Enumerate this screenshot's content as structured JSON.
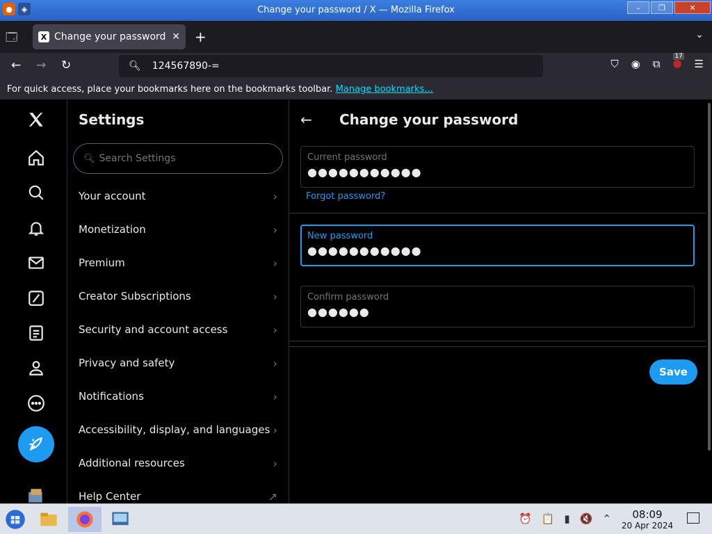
{
  "window": {
    "title": "Change your password / X — Mozilla Firefox",
    "minimize": "–",
    "maximize": "❐",
    "close": "✕"
  },
  "browser": {
    "tab_title": "Change your password /",
    "tab_favicon": "X",
    "url": "124567890-=",
    "extension_badge_count": "17",
    "bookmarks_message": "For quick access, place your bookmarks here on the bookmarks toolbar.",
    "manage_bookmarks": "Manage bookmarks..."
  },
  "settings": {
    "title": "Settings",
    "search_placeholder": "Search Settings",
    "items": [
      {
        "label": "Your account"
      },
      {
        "label": "Monetization"
      },
      {
        "label": "Premium"
      },
      {
        "label": "Creator Subscriptions"
      },
      {
        "label": "Security and account access"
      },
      {
        "label": "Privacy and safety"
      },
      {
        "label": "Notifications"
      },
      {
        "label": "Accessibility, display, and languages"
      },
      {
        "label": "Additional resources"
      },
      {
        "label": "Help Center"
      }
    ]
  },
  "form": {
    "title": "Change your password",
    "current_label": "Current password",
    "current_value": "●●●●●●●●●●●",
    "forgot": "Forgot password?",
    "new_label": "New password",
    "new_value": "●●●●●●●●●●●",
    "confirm_label": "Confirm password",
    "confirm_value": "●●●●●●",
    "save": "Save"
  },
  "taskbar": {
    "time": "08:09",
    "date": "20 Apr 2024"
  },
  "colors": {
    "accent": "#1d9bf0",
    "background": "#000000",
    "border": "#2f3336",
    "muted_text": "#71767b"
  }
}
